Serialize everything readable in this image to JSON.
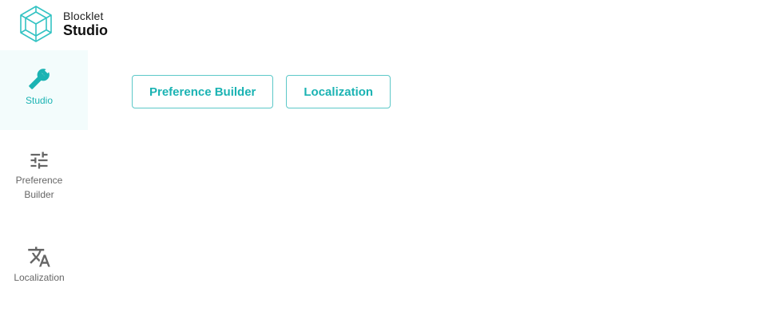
{
  "logo": {
    "line1": "Blocklet",
    "line2": "Studio",
    "icon": "blocklet-hexagon-icon",
    "color": "#33c3c3"
  },
  "sidebar": {
    "items": [
      {
        "label": "Studio",
        "icon": "tools-icon",
        "active": true
      },
      {
        "label": "Preference Builder",
        "label_line1": "Preference",
        "label_line2": "Builder",
        "icon": "sliders-icon",
        "active": false
      },
      {
        "label": "Localization",
        "icon": "translate-icon",
        "active": false
      }
    ]
  },
  "main": {
    "buttons": [
      {
        "label": "Preference Builder"
      },
      {
        "label": "Localization"
      }
    ]
  },
  "colors": {
    "accent": "#1bb3b3",
    "active_bg": "#f3fcfc",
    "icon_gray": "#666666"
  }
}
